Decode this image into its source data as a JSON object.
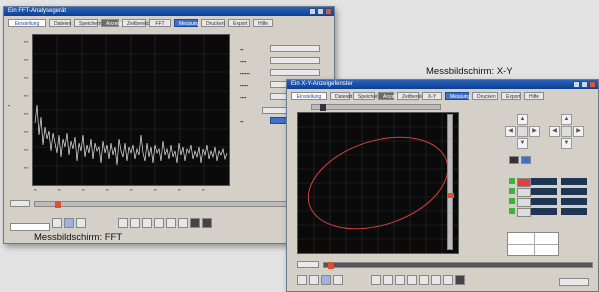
{
  "captions": {
    "fft": "Messbildschirm: FFT",
    "xy": "Messbildschirm: X-Y"
  },
  "fft_window": {
    "title": "Ein FFT-Analysegerät",
    "tabs": [
      "Einstellung",
      "Dateien",
      "Speichern",
      "Anzeige",
      "Zeitbereich",
      "FFT",
      "Messung",
      "Drucken",
      "Export",
      "Hilfe"
    ]
  },
  "xy_window": {
    "title": "Ein X-Y-Anzeigefenster",
    "tabs": [
      "Einstellung",
      "Dateien",
      "Speichern",
      "Anzeige",
      "Zeitbereich",
      "X-Y",
      "Messung",
      "Drucken",
      "Export",
      "Hilfe"
    ]
  },
  "colors": {
    "title_bar": "#0a3f95",
    "tab_highlight": "#3e72c8",
    "fft_trace": "#e8e8e8",
    "xy_trace": "#d04040"
  }
}
